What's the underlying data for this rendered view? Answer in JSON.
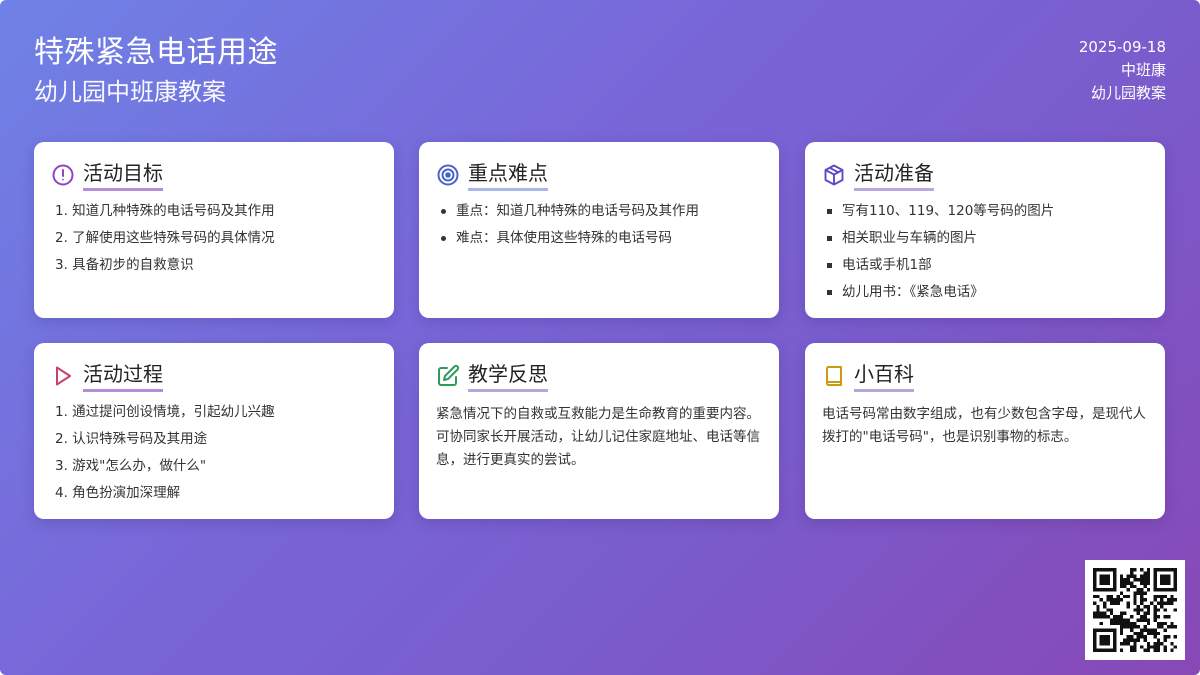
{
  "header": {
    "title": "特殊紧急电话用途",
    "subtitle": "幼儿园中班康教案",
    "date": "2025-09-18",
    "class_name": "中班康",
    "doc_type": "幼儿园教案"
  },
  "cards": [
    {
      "title": "活动目标",
      "icon": "exclamation-circle-icon",
      "icon_color": "#8e44c9",
      "items": [
        "1. 知道几种特殊的电话号码及其作用",
        "2. 了解使用这些特殊号码的具体情况",
        "3. 具备初步的自救意识"
      ]
    },
    {
      "title": "重点难点",
      "icon": "target-icon",
      "icon_color": "#4a63c7",
      "items": [
        "重点：知道几种特殊的电话号码及其作用",
        "难点：具体使用这些特殊的电话号码"
      ]
    },
    {
      "title": "活动准备",
      "icon": "box-icon",
      "icon_color": "#5b4bc4",
      "items": [
        "写有110、119、120等号码的图片",
        "相关职业与车辆的图片",
        "电话或手机1部",
        "幼儿用书：《紧急电话》"
      ]
    },
    {
      "title": "活动过程",
      "icon": "play-icon",
      "icon_color": "#c8406e",
      "items": [
        "1. 通过提问创设情境，引起幼儿兴趣",
        "2. 认识特殊号码及其用途",
        "3. 游戏\"怎么办，做什么\"",
        "4. 角色扮演加深理解"
      ]
    },
    {
      "title": "教学反思",
      "icon": "edit-icon",
      "icon_color": "#2e9b5a",
      "text": "紧急情况下的自救或互救能力是生命教育的重要内容。可协同家长开展活动，让幼儿记住家庭地址、电话等信息，进行更真实的尝试。"
    },
    {
      "title": "小百科",
      "icon": "book-icon",
      "icon_color": "#c99a12",
      "text": "电话号码常由数字组成，也有少数包含字母，是现代人拨打的\"电话号码\"，也是识别事物的标志。"
    }
  ],
  "qr_icon": "qr-code-icon"
}
